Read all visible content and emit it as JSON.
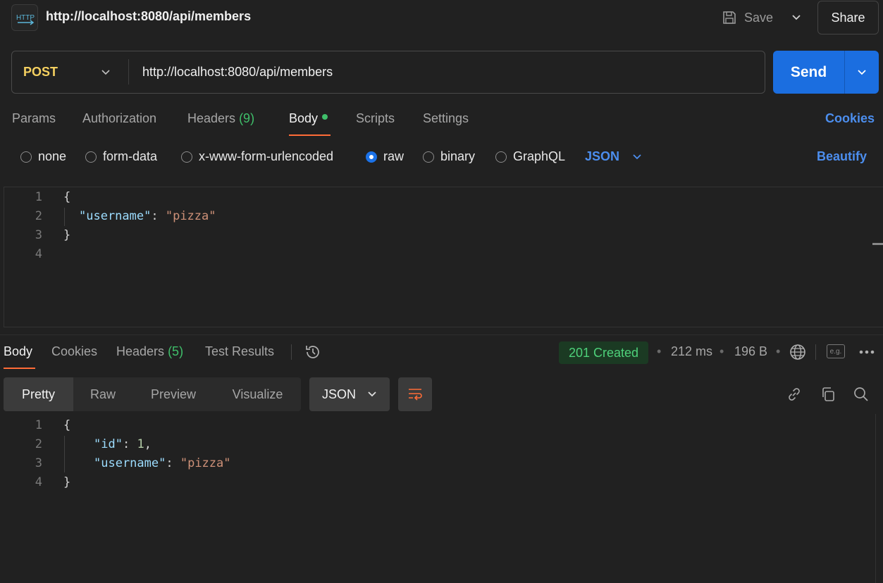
{
  "header": {
    "icon_label": "HTTP",
    "title": "http://localhost:8080/api/members",
    "save_label": "Save",
    "share_label": "Share"
  },
  "request": {
    "method": "POST",
    "url": "http://localhost:8080/api/members",
    "send_label": "Send",
    "tabs": {
      "params": "Params",
      "authorization": "Authorization",
      "headers": "Headers",
      "headers_count": "(9)",
      "body": "Body",
      "scripts": "Scripts",
      "settings": "Settings"
    },
    "cookies_label": "Cookies",
    "body_types": {
      "none": "none",
      "form_data": "form-data",
      "urlencoded": "x-www-form-urlencoded",
      "raw": "raw",
      "binary": "binary",
      "graphql": "GraphQL"
    },
    "selected_body_type": "raw",
    "format": "JSON",
    "beautify_label": "Beautify",
    "editor": {
      "line_numbers": [
        "1",
        "2",
        "3",
        "4"
      ],
      "open_brace": "{",
      "close_brace": "}",
      "key": "\"username\"",
      "colon": ": ",
      "value": "\"pizza\""
    }
  },
  "response": {
    "tabs": {
      "body": "Body",
      "cookies": "Cookies",
      "headers": "Headers",
      "headers_count": "(5)",
      "test_results": "Test Results"
    },
    "status": "201 Created",
    "time": "212 ms",
    "size": "196 B",
    "bullet": "•",
    "eg_label": "e.g.",
    "views": {
      "pretty": "Pretty",
      "raw": "Raw",
      "preview": "Preview",
      "visualize": "Visualize"
    },
    "format": "JSON",
    "editor": {
      "line_numbers": [
        "1",
        "2",
        "3",
        "4"
      ],
      "open_brace": "{",
      "close_brace": "}",
      "id_key": "\"id\"",
      "colon": ": ",
      "id_value": "1",
      "comma": ",",
      "username_key": "\"username\"",
      "username_value": "\"pizza\""
    }
  },
  "colors": {
    "accent": "#ff6c37",
    "primary": "#1b6ee0",
    "link": "#4c8eee",
    "success": "#4ed17a",
    "method": "#f5d060"
  }
}
